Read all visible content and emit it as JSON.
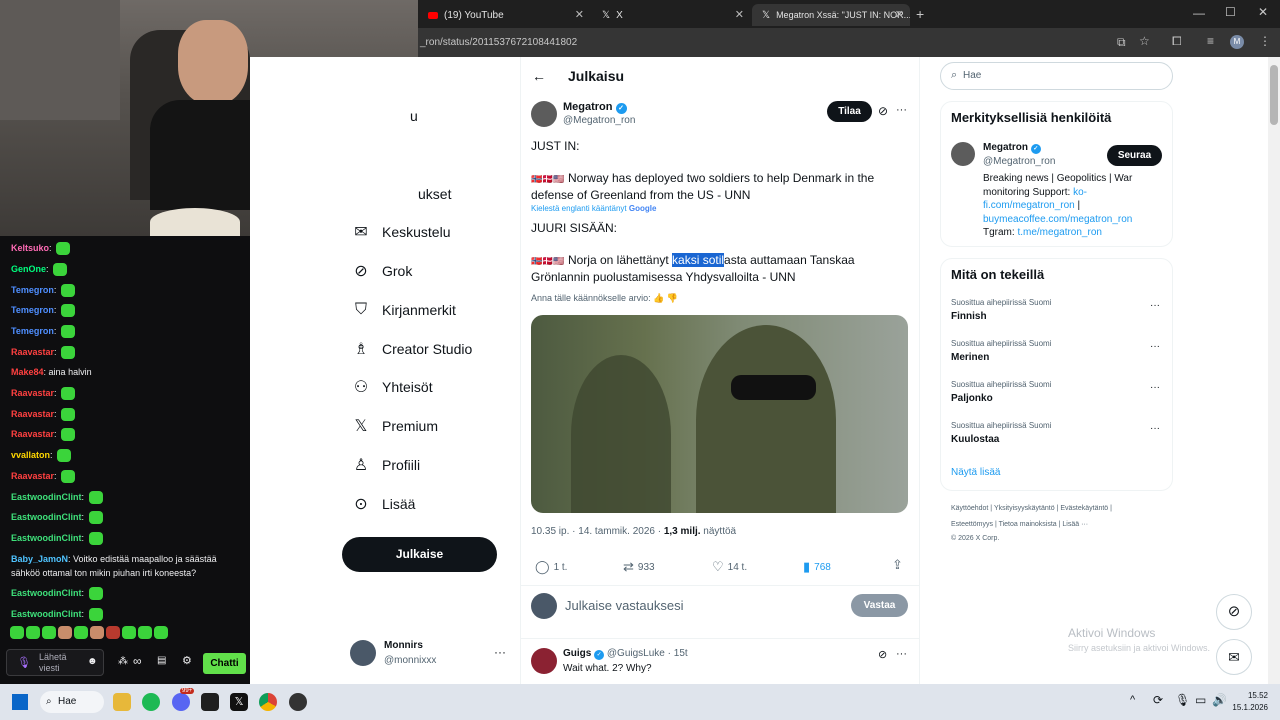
{
  "browser": {
    "tabs": [
      {
        "label": "(19) YouTube"
      },
      {
        "label": "X"
      },
      {
        "label": "Megatron Xssä: \"JUST IN: NOR..."
      }
    ],
    "url": "_ron/status/2011537672108441802"
  },
  "nav": {
    "items": [
      {
        "label": "u"
      },
      {
        "label": "ukset"
      },
      {
        "label": "Keskustelu"
      },
      {
        "label": "Grok"
      },
      {
        "label": "Kirjanmerkit"
      },
      {
        "label": "Creator Studio"
      },
      {
        "label": "Yhteisöt"
      },
      {
        "label": "Premium"
      },
      {
        "label": "Profiili"
      },
      {
        "label": "Lisää"
      }
    ],
    "post_button": "Julkaise",
    "account": {
      "name": "Monnirs",
      "handle": "@monnixxx"
    }
  },
  "header": {
    "title": "Julkaisu"
  },
  "post": {
    "author": "Megatron",
    "handle": "@Megatron_ron",
    "subscribe": "Tilaa",
    "line1": "JUST IN:",
    "line2": "Norway has deployed two soldiers to help Denmark in the defense of Greenland from the US - UNN",
    "translated_by": "Kielestä englanti kääntänyt",
    "google": "Google",
    "tr1": "JUURI SISÄÄN:",
    "tr2_pre": "Norja on lähettänyt ",
    "tr2_sel": "kaksi sotil",
    "tr2_post": "asta auttamaan Tanskaa Grönlannin puolustamisessa Yhdysvalloilta - UNN",
    "rate": "Anna tälle käännökselle arvio:",
    "meta_time": "10.35 ip. · 14. tammik. 2026 · ",
    "meta_views": "1,3 milj.",
    "meta_views_label": " näyttöä",
    "stats": {
      "replies": "1 t.",
      "reposts": "933",
      "likes": "14 t.",
      "bookmarks": "768"
    },
    "reply_placeholder": "Julkaise vastauksesi",
    "reply_button": "Vastaa"
  },
  "reply": {
    "author": "Guigs",
    "handle": "@GuigsLuke · 15t",
    "text": "Wait what. 2? Why?"
  },
  "right": {
    "search_placeholder": "Hae",
    "who_title": "Merkityksellisiä henkilöitä",
    "who_name": "Megatron",
    "who_handle": "@Megatron_ron",
    "follow": "Seuraa",
    "bio1": "Breaking news | Geopolitics | War monitoring Support: ",
    "bio_link1": "ko-fi.com/megatron_ron",
    "bio_sep": " | ",
    "bio_link2": "buymeacoffee.com/megatron_ron",
    "bio2": "Tgram: ",
    "bio_link3": "t.me/megatron_ron",
    "trends_title": "Mitä on tekeillä",
    "trends": [
      {
        "sub": "Suosittua aihepiirissä Suomi",
        "name": "Finnish"
      },
      {
        "sub": "Suosittua aihepiirissä Suomi",
        "name": "Merinen"
      },
      {
        "sub": "Suosittua aihepiirissä Suomi",
        "name": "Paljonko"
      },
      {
        "sub": "Suosittua aihepiirissä Suomi",
        "name": "Kuulostaa"
      }
    ],
    "show_more": "Näytä lisää",
    "footer1": "Käyttöehdot | Yksityisyyskäytäntö | Evästekäytäntö |",
    "footer2": "Esteettömyys | Tietoa mainoksista | Lisää ···",
    "footer3": "© 2026 X Corp.",
    "activate1": "Aktivoi Windows",
    "activate2": "Siirry asetuksiin ja aktivoi Windows."
  },
  "chat": {
    "lines": [
      {
        "user": "Keltsuko",
        "color": "#ff6bb5",
        "text": ""
      },
      {
        "user": "GenOne",
        "color": "#00ff7f",
        "text": ""
      },
      {
        "user": "Temegron",
        "color": "#4f8fff",
        "text": ""
      },
      {
        "user": "Temegron",
        "color": "#4f8fff",
        "text": ""
      },
      {
        "user": "Temegron",
        "color": "#4f8fff",
        "text": ""
      },
      {
        "user": "Raavastar",
        "color": "#ff4040",
        "text": ""
      },
      {
        "user": "Make84",
        "color": "#ff4040",
        "text": "aina halvin"
      },
      {
        "user": "Raavastar",
        "color": "#ff4040",
        "text": ""
      },
      {
        "user": "Raavastar",
        "color": "#ff4040",
        "text": ""
      },
      {
        "user": "Raavastar",
        "color": "#ff4040",
        "text": ""
      },
      {
        "user": "vvallaton",
        "color": "#ffd700",
        "text": ""
      },
      {
        "user": "Raavastar",
        "color": "#ff4040",
        "text": ""
      },
      {
        "user": "EastwoodinClint",
        "color": "#3ee07a",
        "text": ""
      },
      {
        "user": "EastwoodinClint",
        "color": "#3ee07a",
        "text": ""
      },
      {
        "user": "EastwoodinClint",
        "color": "#3ee07a",
        "text": ""
      },
      {
        "user": "Baby_JamoN",
        "color": "#4fc3ff",
        "text": "Voitko edistää maapalloo ja säästää"
      },
      {
        "user": "",
        "color": "#efeff1",
        "text": "sähköö ottamal ton mikin piuhan irti koneesta?"
      },
      {
        "user": "EastwoodinClint",
        "color": "#3ee07a",
        "text": ""
      },
      {
        "user": "EastwoodinClint",
        "color": "#3ee07a",
        "text": ""
      }
    ],
    "input_placeholder": "Lähetä viesti",
    "send": "Chatti",
    "points": "∞"
  },
  "taskbar": {
    "search": "Hae",
    "time": "15.52",
    "date": "15.1.2026",
    "badge": "99+"
  }
}
